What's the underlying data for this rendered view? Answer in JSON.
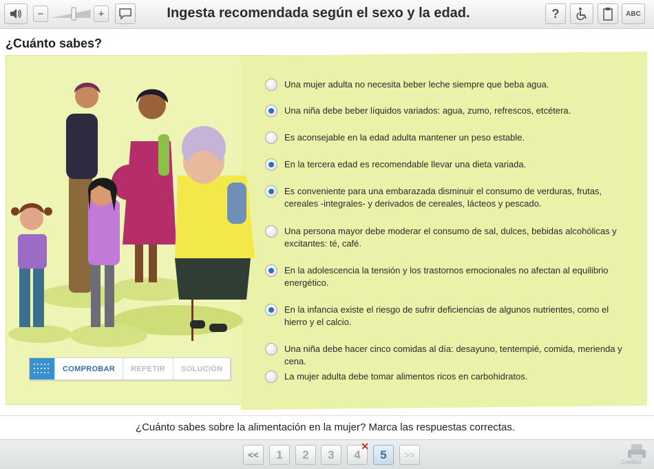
{
  "toolbar": {
    "title": "Ingesta recomendada según el sexo y la edad.",
    "help_label": "?",
    "abc_label": "ABC",
    "minus_label": "−",
    "plus_label": "+"
  },
  "section_title": "¿Cuánto sabes?",
  "options": [
    {
      "text": "Una mujer adulta no necesita beber leche siempre que beba agua.",
      "selected": false
    },
    {
      "text": "Una niña debe beber líquidos variados: agua, zumo, refrescos, etcétera.",
      "selected": true
    },
    {
      "text": "Es aconsejable en la edad adulta mantener un peso estable.",
      "selected": false
    },
    {
      "text": "En la tercera edad es recomendable llevar una dieta variada.",
      "selected": true
    },
    {
      "text": "Es conveniente para una embarazada disminuir el consumo de verduras, frutas, cereales -integrales- y derivados de cereales, lácteos y pescado.",
      "selected": true
    },
    {
      "text": "Una persona mayor debe moderar el consumo de sal, dulces, bebidas alcohólicas y excitantes: té, café.",
      "selected": false
    },
    {
      "text": "En la adolescencia la tensión y los trastornos emocionales no afectan al equilibrio energético.",
      "selected": true
    },
    {
      "text": "En la infancia existe el riesgo de sufrir deficiencias de algunos nutrientes, como el hierro y el calcio.",
      "selected": true
    },
    {
      "text": "Una niña debe hacer cinco comidas al día: desayuno, tentempié, comida, merienda y cena.",
      "selected": false
    },
    {
      "text": "La mujer adulta debe tomar alimentos ricos en carbohidratos.",
      "selected": false
    }
  ],
  "actions": {
    "check": "COMPROBAR",
    "retry": "REPETIR",
    "solution": "SOLUCIÓN"
  },
  "instruction": "¿Cuánto sabes sobre la alimentación en la mujer? Marca las respuestas correctas.",
  "nav": {
    "first": "<<",
    "pages": [
      "1",
      "2",
      "3",
      "4",
      "5"
    ],
    "current_page": "5",
    "next": ">>"
  },
  "credit": "Créditos",
  "colors": {
    "panel": "#eef4b4",
    "accent": "#2f6fa8",
    "radio_selected": "#2b6fb4"
  }
}
